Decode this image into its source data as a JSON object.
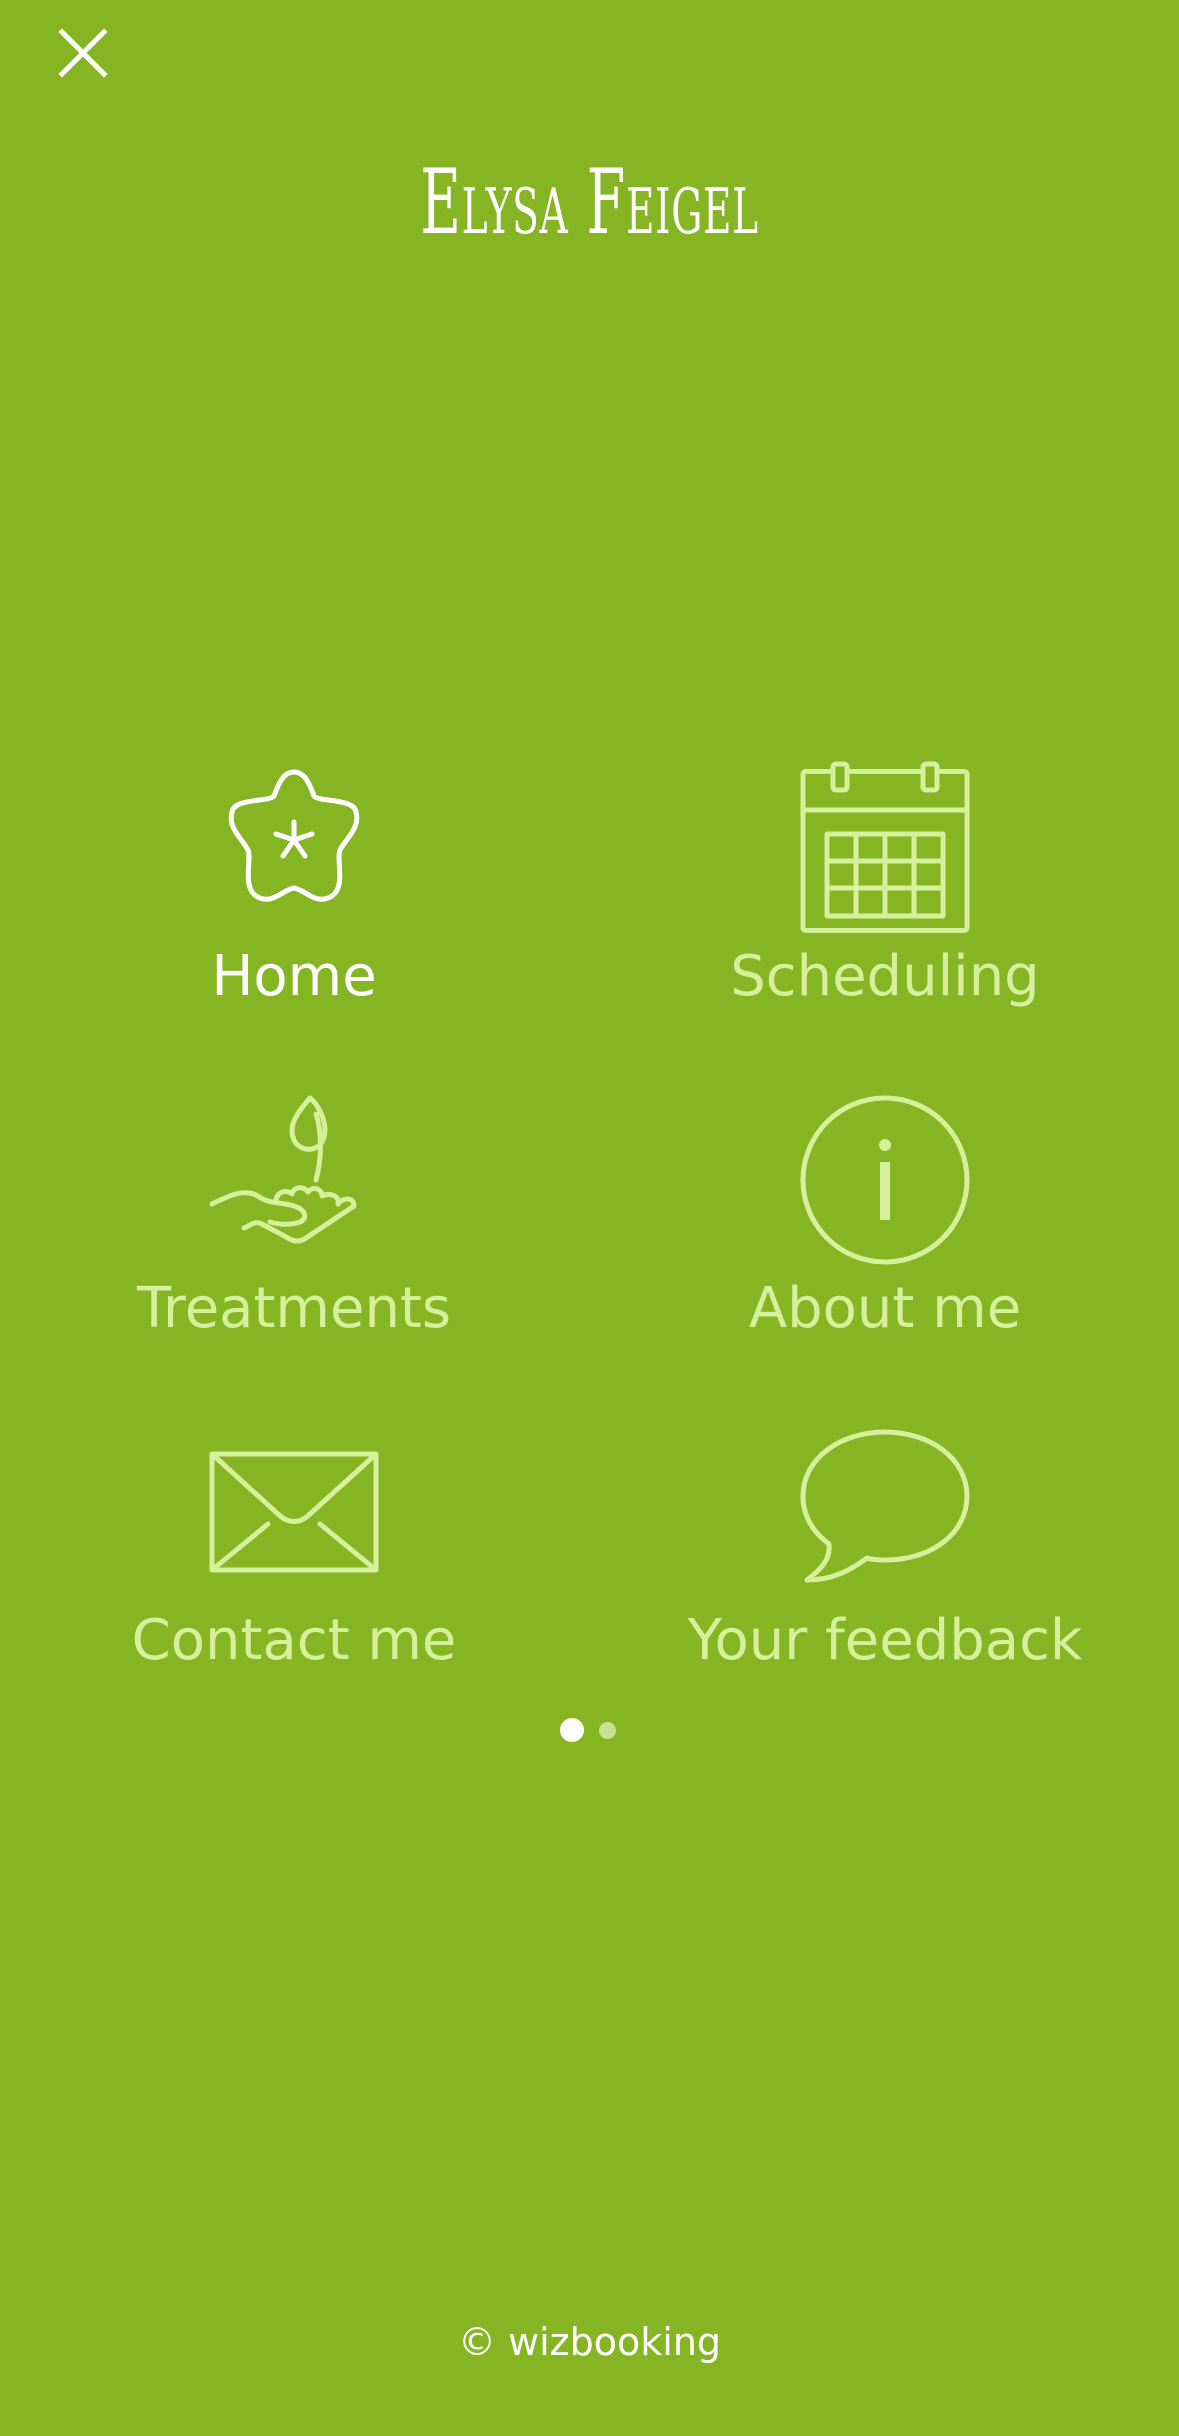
{
  "header": {
    "title": "Elysa Feigel",
    "close_icon": "close-icon"
  },
  "menu": {
    "items": [
      {
        "label": "Home",
        "icon": "flower-icon",
        "active": true
      },
      {
        "label": "Scheduling",
        "icon": "calendar-icon",
        "active": false
      },
      {
        "label": "Treatments",
        "icon": "hand-sprout-icon",
        "active": false
      },
      {
        "label": "About me",
        "icon": "info-icon",
        "active": false
      },
      {
        "label": "Contact me",
        "icon": "envelope-icon",
        "active": false
      },
      {
        "label": "Your feedback",
        "icon": "speech-bubble-icon",
        "active": false
      }
    ]
  },
  "pagination": {
    "pages": 2,
    "current": 1
  },
  "footer": {
    "text": "© wizbooking"
  },
  "colors": {
    "background": "#86b524",
    "active_text": "#ffffff",
    "inactive_text": "#d6ef9b"
  }
}
